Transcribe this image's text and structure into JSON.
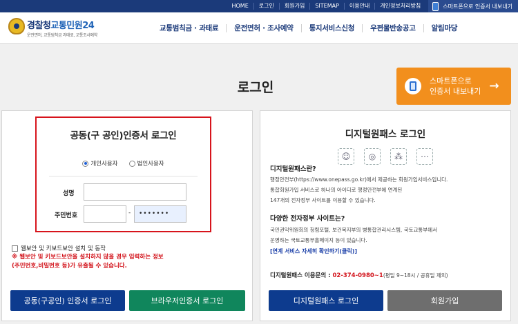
{
  "topbar": {
    "links": [
      "HOME",
      "로그인",
      "회원가입",
      "SITEMAP",
      "이용안내",
      "개인정보처리방침"
    ],
    "smartphone_label": "스마트폰으로 인증서 내보내기"
  },
  "header": {
    "logo_prefix": "경찰청",
    "logo_highlight": "교통민원24",
    "logo_sub": "운전면허, 교통범칙금 과태료, 교통조사예약",
    "nav": [
      "교통범칙금 · 과태료",
      "운전면허 · 조사예약",
      "통지서비스신청",
      "우편물반송공고",
      "알림마당"
    ]
  },
  "page": {
    "title": "로그인",
    "export_line1": "스마트폰으로",
    "export_line2": "인증서 내보내기",
    "export_arrow": "→"
  },
  "cert": {
    "title": "공동(구 공인)인증서 로그인",
    "radio_personal": "개인사용자",
    "radio_corporate": "법인사용자",
    "name_label": "성명",
    "rrn_label": "주민번호",
    "rrn_dash": "-",
    "rrn_back_value": "•••••••",
    "security_check": "웹보안 및 키보드보안 설치 및 동작",
    "warning_line1": "※ 웹보안 및 키보드보안을 설치하지 않을 경우 입력하는 정보",
    "warning_line2": "(주민번호,비밀번호 등)가 유출될 수 있습니다.",
    "btn_cert_login": "공동(구공인) 인증서 로그인",
    "btn_browser_login": "브라우저인증서 로그인"
  },
  "digital": {
    "title": "디지털원패스 로그인",
    "q1": "디지털원패스란?",
    "desc1_1": "행정안전부(https://www.onepass.go.kr)에서 제공하는 회원가입서비스입니다.",
    "desc1_2": "통합회원가입 서비스로 하나의 아이디로 행정안전부에 연계된",
    "desc1_3": "147개의 전자정부 사이트를 이용할 수 있습니다.",
    "q2": "다양한 전자정부 사이트는?",
    "desc2_1": "국민권익위원회의 청렴포털, 보건복지부의 병통합관리시스템, 국토교통부에서",
    "desc2_2": "운영하는 국토교통부홈페이지 등이 있습니다.",
    "link": "[연계 서비스 자세히 확인하기(클릭)]",
    "contact_label": "디지털원패스 이용문의 :",
    "contact_tel": "02-374-0980~1",
    "contact_hours": "(평일 9~18시 / 공휴일 제외)",
    "btn_login": "디지털원패스 로그인",
    "btn_join": "회원가입"
  },
  "icons": {
    "face": "face-scan-icon",
    "finger": "fingerprint-icon",
    "pattern": "pattern-icon",
    "dots": "pin-dots-icon"
  }
}
